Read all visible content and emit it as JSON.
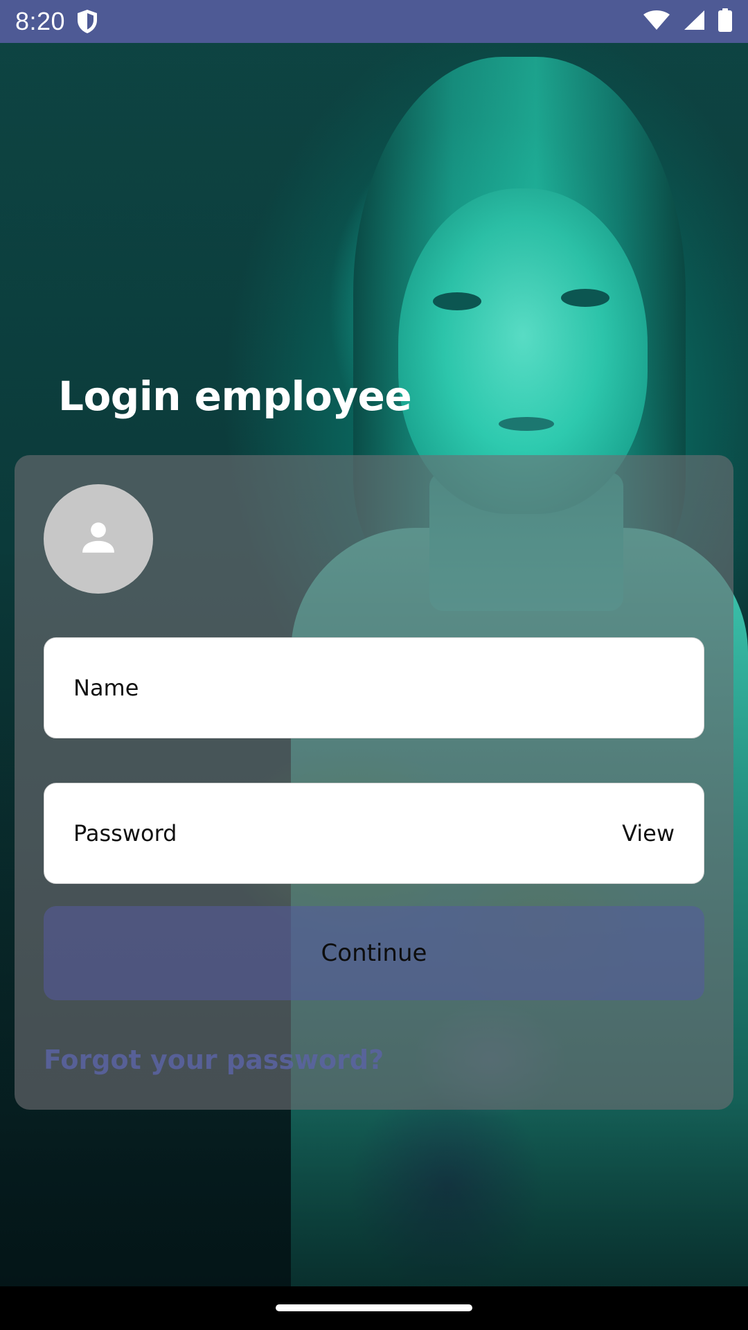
{
  "status_bar": {
    "time": "8:20",
    "icons": [
      "shield-icon",
      "wifi-icon",
      "signal-icon",
      "battery-icon"
    ]
  },
  "login": {
    "title": "Login employee",
    "avatar_icon": "person-icon",
    "name_placeholder": "Name",
    "password_placeholder": "Password",
    "view_label": "View",
    "continue_label": "Continue",
    "forgot_label": "Forgot your password?"
  },
  "colors": {
    "status_bar": "#4e5a95",
    "card": "#6e6e73",
    "continue_button": "#555aa0",
    "forgot_link": "#5b63a3"
  }
}
